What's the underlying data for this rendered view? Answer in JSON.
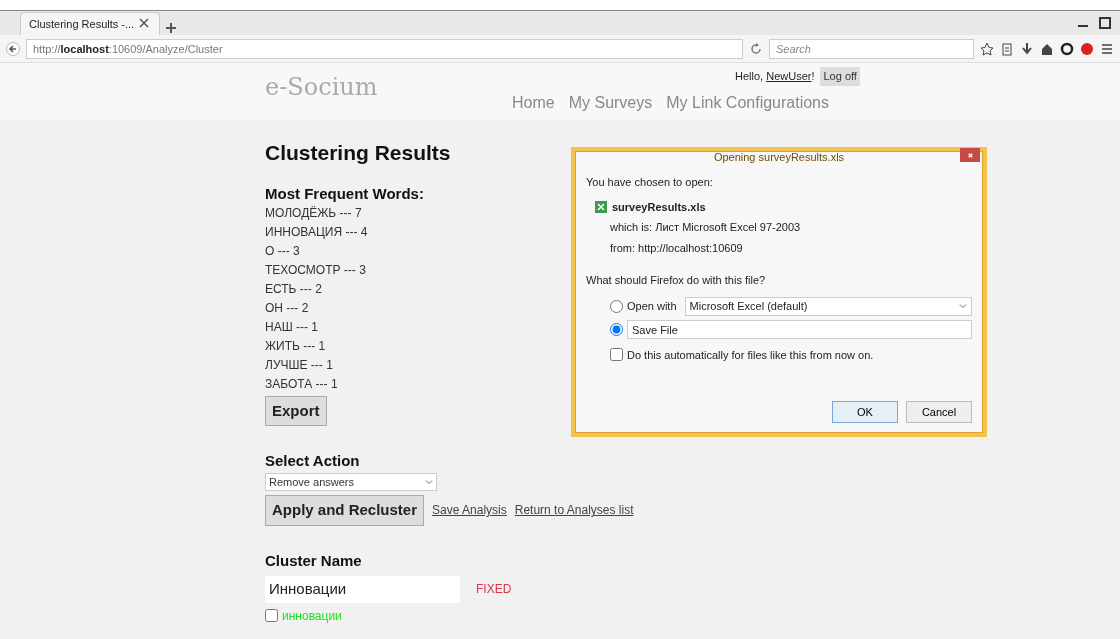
{
  "browser": {
    "tab_title": "Clustering Results -...",
    "url_prefix": "http://",
    "url_host": "localhost",
    "url_rest": ":10609/Analyze/Cluster",
    "search_placeholder": "Search"
  },
  "header": {
    "logo": "e-Socium",
    "greeting": "Hello, ",
    "user": "NewUser",
    "greeting_end": "!",
    "logoff": "Log off",
    "nav": [
      "Home",
      "My Surveys",
      "My Link Configurations"
    ]
  },
  "page": {
    "title": "Clustering Results",
    "words_heading": "Most Frequent Words:",
    "words": [
      "МОЛОДЁЖЬ --- 7",
      "ИННОВАЦИЯ --- 4",
      "О --- 3",
      "ТЕХОСМОТР --- 3",
      "ЕСТЬ --- 2",
      "ОН --- 2",
      "НАШ --- 1",
      "ЖИТЬ --- 1",
      "ЛУЧШЕ --- 1",
      "ЗАБОТА --- 1"
    ],
    "export": "Export",
    "action_heading": "Select Action",
    "action_value": "Remove answers",
    "apply": "Apply and Recluster",
    "links": [
      "Save Analysis",
      "Return to Analyses list"
    ],
    "cluster_heading": "Cluster Name",
    "cluster_name": "Инновации",
    "cluster_status": "FIXED",
    "answers": [
      {
        "text": "инновации",
        "checked": false
      }
    ]
  },
  "dialog": {
    "title": "Opening surveyResults.xls",
    "intro": "You have chosen to open:",
    "file": "surveyResults.xls",
    "which": "which is: Лист Microsoft Excel 97-2003",
    "from": "from: http://localhost:10609",
    "question": "What should Firefox do with this file?",
    "options": [
      {
        "label": "Open with",
        "selected": false,
        "app": "Microsoft Excel (default)"
      },
      {
        "label": "Save File",
        "selected": true
      }
    ],
    "auto": {
      "label": "Do this automatically for files like this from now on.",
      "checked": false
    },
    "ok": "OK",
    "cancel": "Cancel"
  }
}
